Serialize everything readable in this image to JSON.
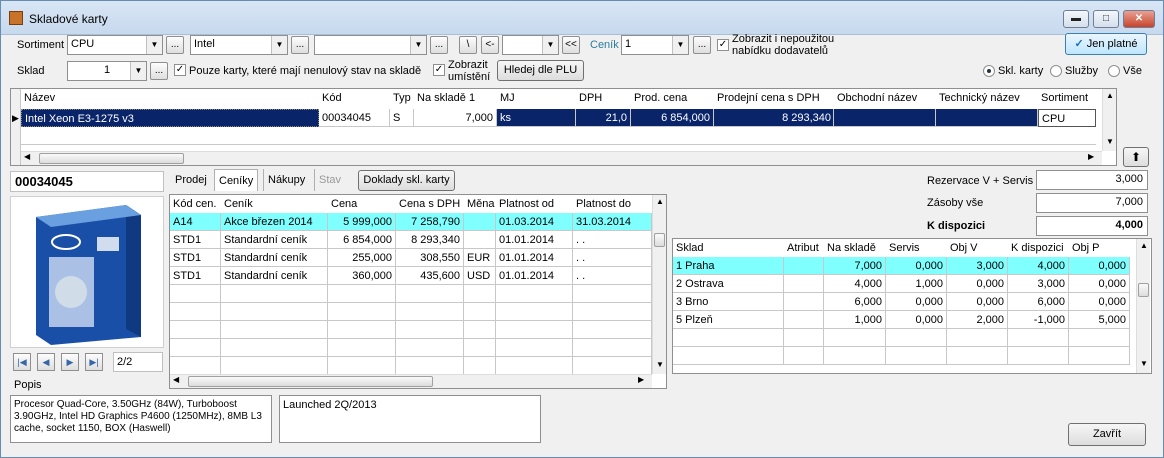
{
  "window": {
    "title": "Skladové karty",
    "min": "▬",
    "max": "□",
    "close": "✕"
  },
  "filters": {
    "sortiment_label": "Sortiment",
    "sortiment_value": "CPU",
    "brand_value": "Intel",
    "third_value": "",
    "cenik_label": "Ceník",
    "cenik_value": "1",
    "show_unused_label": "Zobrazit i nepoužitou nabídku dodavatelů",
    "only_prices_label": "Jen platné",
    "sklad_label": "Sklad",
    "sklad_value": "1",
    "nonzero_label": "Pouze karty, které mají nenulový stav na skladě",
    "show_location_label": "Zobrazit umístění",
    "search_plu_label": "Hledej dle PLU",
    "dots": "...",
    "back_btn": "\\",
    "prev_btn": "<-",
    "first_btn": "<<",
    "radio_skl": "Skl. karty",
    "radio_sluzby": "Služby",
    "radio_vse": "Vše"
  },
  "main_grid": {
    "headers": [
      "Název",
      "Kód",
      "Typ",
      "Na skladě 1",
      "MJ",
      "DPH",
      "Prod. cena",
      "Prodejní cena s DPH",
      "Obchodní název",
      "Technický název",
      "Sortiment"
    ],
    "rows": [
      [
        "Intel Xeon E3-1275 v3",
        "00034045",
        "S",
        "7,000",
        "ks",
        "21,0",
        "6 854,000",
        "8 293,340",
        "",
        "",
        "CPU"
      ]
    ]
  },
  "card_code": "00034045",
  "tabs": [
    "Prodej",
    "Ceníky",
    "Nákupy",
    "Stav"
  ],
  "doklady_label": "Doklady skl. karty",
  "price_grid": {
    "headers": [
      "Kód cen.",
      "Ceník",
      "Cena",
      "Cena s DPH",
      "Měna",
      "Platnost od",
      "Platnost do"
    ],
    "rows": [
      [
        "A14",
        "Akce březen 2014",
        "5 999,000",
        "7 258,790",
        "",
        "01.03.2014",
        "31.03.2014"
      ],
      [
        "STD1",
        "Standardní ceník",
        "6 854,000",
        "8 293,340",
        "",
        "01.01.2014",
        ". ."
      ],
      [
        "STD1",
        "Standardní ceník",
        "255,000",
        "308,550",
        "EUR",
        "01.01.2014",
        ". ."
      ],
      [
        "STD1",
        "Standardní ceník",
        "360,000",
        "435,600",
        "USD",
        "01.01.2014",
        ". ."
      ]
    ]
  },
  "summary": {
    "reservation_label": "Rezervace V + Servis",
    "reservation_value": "3,000",
    "stock_label": "Zásoby vše",
    "stock_value": "7,000",
    "available_label": "K dispozici",
    "available_value": "4,000"
  },
  "stock_grid": {
    "headers": [
      "Sklad",
      "Atribut",
      "Na skladě",
      "Servis",
      "Obj V",
      "K dispozici",
      "Obj P"
    ],
    "rows": [
      [
        "1  Praha",
        "",
        "7,000",
        "0,000",
        "3,000",
        "4,000",
        "0,000"
      ],
      [
        "2  Ostrava",
        "",
        "4,000",
        "1,000",
        "0,000",
        "3,000",
        "0,000"
      ],
      [
        "3  Brno",
        "",
        "6,000",
        "0,000",
        "0,000",
        "6,000",
        "0,000"
      ],
      [
        "5  Plzeň",
        "",
        "1,000",
        "0,000",
        "2,000",
        "-1,000",
        "5,000"
      ]
    ]
  },
  "pager": "2/2",
  "popis_label": "Popis",
  "description": "Procesor Quad-Core, 3.50GHz (84W), Turboboost 3.90GHz, Intel HD Graphics P4600 (1250MHz), 8MB L3 cache, socket 1150, BOX (Haswell)",
  "note": "Launched 2Q/2013",
  "close_label": "Zavřít"
}
